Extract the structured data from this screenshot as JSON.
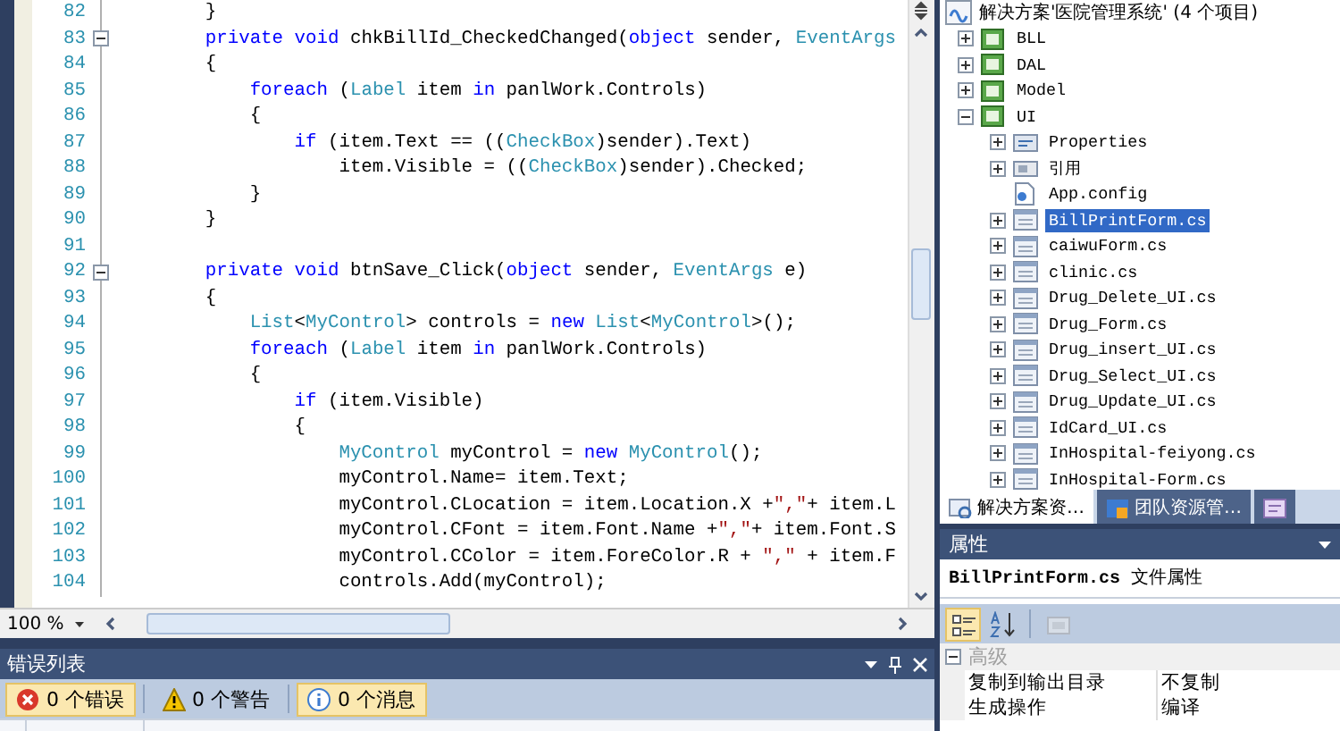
{
  "editor": {
    "lines": [
      {
        "number": "82",
        "fold": false,
        "segments": [
          {
            "kind": "plain",
            "text": "        }"
          }
        ]
      },
      {
        "number": "83",
        "fold": true,
        "segments": [
          {
            "kind": "keyword",
            "text": "        private void"
          },
          {
            "kind": "plain",
            "text": " chkBillId_CheckedChanged("
          },
          {
            "kind": "keyword",
            "text": "object"
          },
          {
            "kind": "plain",
            "text": " sender, "
          },
          {
            "kind": "type",
            "text": "EventArgs"
          }
        ]
      },
      {
        "number": "84",
        "fold": false,
        "segments": [
          {
            "kind": "plain",
            "text": "        {"
          }
        ]
      },
      {
        "number": "85",
        "fold": false,
        "segments": [
          {
            "kind": "keyword",
            "text": "            foreach"
          },
          {
            "kind": "plain",
            "text": " ("
          },
          {
            "kind": "type",
            "text": "Label"
          },
          {
            "kind": "plain",
            "text": " item "
          },
          {
            "kind": "keyword",
            "text": "in"
          },
          {
            "kind": "plain",
            "text": " panlWork.Controls)"
          }
        ]
      },
      {
        "number": "86",
        "fold": false,
        "segments": [
          {
            "kind": "plain",
            "text": "            {"
          }
        ]
      },
      {
        "number": "87",
        "fold": false,
        "segments": [
          {
            "kind": "keyword",
            "text": "                if"
          },
          {
            "kind": "plain",
            "text": " (item.Text == (("
          },
          {
            "kind": "type",
            "text": "CheckBox"
          },
          {
            "kind": "plain",
            "text": ")sender).Text)"
          }
        ]
      },
      {
        "number": "88",
        "fold": false,
        "segments": [
          {
            "kind": "plain",
            "text": "                    item.Visible = (("
          },
          {
            "kind": "type",
            "text": "CheckBox"
          },
          {
            "kind": "plain",
            "text": ")sender).Checked;"
          }
        ]
      },
      {
        "number": "89",
        "fold": false,
        "segments": [
          {
            "kind": "plain",
            "text": "            }"
          }
        ]
      },
      {
        "number": "90",
        "fold": false,
        "segments": [
          {
            "kind": "plain",
            "text": "        }"
          }
        ]
      },
      {
        "number": "91",
        "fold": false
      },
      {
        "number": "92",
        "fold": true,
        "segments": [
          {
            "kind": "keyword",
            "text": "        private void"
          },
          {
            "kind": "plain",
            "text": " btnSave_Click("
          },
          {
            "kind": "keyword",
            "text": "object"
          },
          {
            "kind": "plain",
            "text": " sender, "
          },
          {
            "kind": "type",
            "text": "EventArgs"
          },
          {
            "kind": "plain",
            "text": " e)"
          }
        ]
      },
      {
        "number": "93",
        "fold": false,
        "segments": [
          {
            "kind": "plain",
            "text": "        {"
          }
        ]
      },
      {
        "number": "94",
        "fold": false,
        "segments": [
          {
            "kind": "type",
            "text": "            List"
          },
          {
            "kind": "plain",
            "text": "<"
          },
          {
            "kind": "type",
            "text": "MyControl"
          },
          {
            "kind": "plain",
            "text": "> controls = "
          },
          {
            "kind": "keyword",
            "text": "new"
          },
          {
            "kind": "type",
            "text": " List"
          },
          {
            "kind": "plain",
            "text": "<"
          },
          {
            "kind": "type",
            "text": "MyControl"
          },
          {
            "kind": "plain",
            "text": ">();"
          }
        ]
      },
      {
        "number": "95",
        "fold": false,
        "segments": [
          {
            "kind": "keyword",
            "text": "            foreach"
          },
          {
            "kind": "plain",
            "text": " ("
          },
          {
            "kind": "type",
            "text": "Label"
          },
          {
            "kind": "plain",
            "text": " item "
          },
          {
            "kind": "keyword",
            "text": "in"
          },
          {
            "kind": "plain",
            "text": " panlWork.Controls)"
          }
        ]
      },
      {
        "number": "96",
        "fold": false,
        "segments": [
          {
            "kind": "plain",
            "text": "            {"
          }
        ]
      },
      {
        "number": "97",
        "fold": false,
        "segments": [
          {
            "kind": "keyword",
            "text": "                if"
          },
          {
            "kind": "plain",
            "text": " (item.Visible)"
          }
        ]
      },
      {
        "number": "98",
        "fold": false,
        "segments": [
          {
            "kind": "plain",
            "text": "                {"
          }
        ]
      },
      {
        "number": "99",
        "fold": false,
        "segments": [
          {
            "kind": "type",
            "text": "                    MyControl"
          },
          {
            "kind": "plain",
            "text": " myControl = "
          },
          {
            "kind": "keyword",
            "text": "new"
          },
          {
            "kind": "type",
            "text": " MyControl"
          },
          {
            "kind": "plain",
            "text": "();"
          }
        ]
      },
      {
        "number": "100",
        "fold": false,
        "segments": [
          {
            "kind": "plain",
            "text": "                    myControl.Name= item.Text;"
          }
        ]
      },
      {
        "number": "101",
        "fold": false,
        "segments": [
          {
            "kind": "plain",
            "text": "                    myControl.CLocation = item.Location.X +"
          },
          {
            "kind": "string",
            "text": "\",\""
          },
          {
            "kind": "plain",
            "text": "+ item.L"
          }
        ]
      },
      {
        "number": "102",
        "fold": false,
        "segments": [
          {
            "kind": "plain",
            "text": "                    myControl.CFont = item.Font.Name +"
          },
          {
            "kind": "string",
            "text": "\",\""
          },
          {
            "kind": "plain",
            "text": "+ item.Font.S"
          }
        ]
      },
      {
        "number": "103",
        "fold": false,
        "segments": [
          {
            "kind": "plain",
            "text": "                    myControl.CColor = item.ForeColor.R + "
          },
          {
            "kind": "string",
            "text": "\",\""
          },
          {
            "kind": "plain",
            "text": " + item.F"
          }
        ]
      },
      {
        "number": "104",
        "fold": false,
        "segments": [
          {
            "kind": "plain",
            "text": "                    controls.Add(myControl);"
          }
        ]
      }
    ],
    "zoom": "100 %"
  },
  "error_list": {
    "title": "错误列表",
    "buttons": [
      {
        "kind": "error",
        "label": "0 个错误",
        "selected": true
      },
      {
        "kind": "warning",
        "label": "0 个警告",
        "selected": false
      },
      {
        "kind": "message",
        "label": "0 个消息",
        "selected": true
      }
    ]
  },
  "solution_explorer": {
    "solution": "解决方案'医院管理系统' (4 个项目)",
    "items": [
      {
        "label": "BLL",
        "kind": "project",
        "expanded": false,
        "selected": false
      },
      {
        "label": "DAL",
        "kind": "project",
        "expanded": false,
        "selected": false
      },
      {
        "label": "Model",
        "kind": "project",
        "expanded": false,
        "selected": false
      },
      {
        "label": "UI",
        "kind": "project",
        "expanded": true,
        "selected": false,
        "children": [
          {
            "label": "Properties",
            "kind": "properties",
            "expanded": false,
            "selected": false
          },
          {
            "label": "引用",
            "kind": "references",
            "expanded": false,
            "selected": false
          },
          {
            "label": "App.config",
            "kind": "config",
            "selected": false
          },
          {
            "label": "BillPrintForm.cs",
            "kind": "form",
            "expanded": false,
            "selected": true
          },
          {
            "label": "caiwuForm.cs",
            "kind": "form",
            "expanded": false,
            "selected": false
          },
          {
            "label": "clinic.cs",
            "kind": "form",
            "expanded": false,
            "selected": false
          },
          {
            "label": "Drug_Delete_UI.cs",
            "kind": "form",
            "expanded": false,
            "selected": false
          },
          {
            "label": "Drug_Form.cs",
            "kind": "form",
            "expanded": false,
            "selected": false
          },
          {
            "label": "Drug_insert_UI.cs",
            "kind": "form",
            "expanded": false,
            "selected": false
          },
          {
            "label": "Drug_Select_UI.cs",
            "kind": "form",
            "expanded": false,
            "selected": false
          },
          {
            "label": "Drug_Update_UI.cs",
            "kind": "form",
            "expanded": false,
            "selected": false
          },
          {
            "label": "IdCard_UI.cs",
            "kind": "form",
            "expanded": false,
            "selected": false
          },
          {
            "label": "InHospital-feiyong.cs",
            "kind": "form",
            "expanded": false,
            "selected": false
          },
          {
            "label": "InHospital-Form.cs",
            "kind": "form",
            "expanded": false,
            "selected": false
          }
        ]
      }
    ],
    "tabs": [
      {
        "kind": "solution",
        "label": "解决方案资…",
        "selected": true
      },
      {
        "kind": "team",
        "label": "团队资源管…",
        "selected": false
      },
      {
        "kind": "classes",
        "selected": false
      }
    ]
  },
  "properties": {
    "title": "属性",
    "object": "**BillPrintForm.cs** 文件属性",
    "tools": [
      {
        "kind": "categorized",
        "selected": true,
        "disabled": false
      },
      {
        "kind": "alphabetical",
        "selected": false,
        "disabled": false
      },
      {
        "kind": "pages",
        "selected": false,
        "disabled": true
      }
    ],
    "categories": [
      {
        "name": "高级",
        "expanded": true,
        "rows": [
          {
            "name": "复制到输出目录",
            "value": "不复制"
          },
          {
            "name": "生成操作",
            "value": "编译"
          }
        ]
      }
    ]
  }
}
